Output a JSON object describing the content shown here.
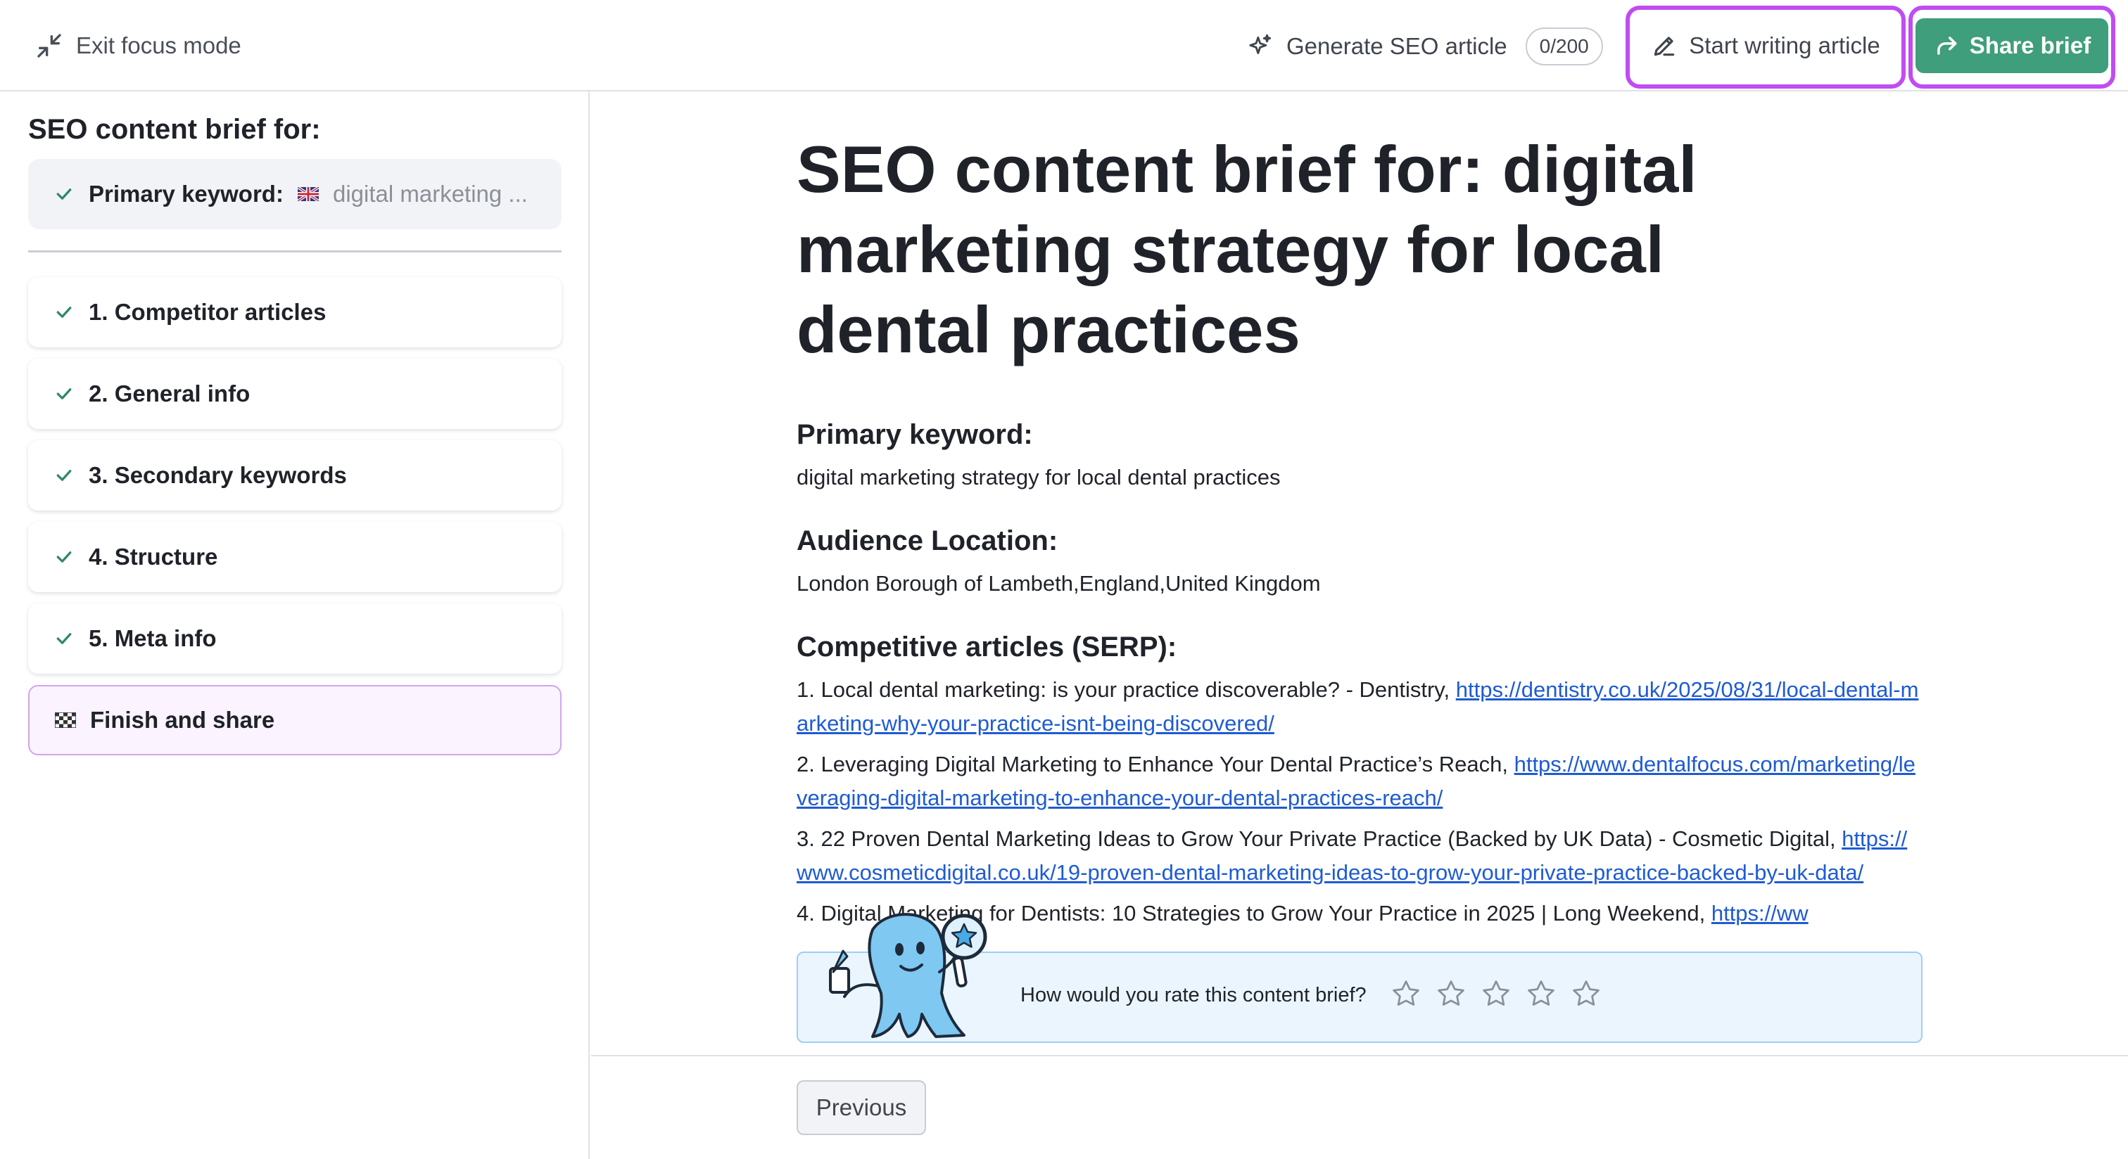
{
  "topbar": {
    "exit_focus_label": "Exit focus mode",
    "generate_label": "Generate SEO article",
    "generate_counter": "0/200",
    "start_writing_label": "Start writing article",
    "share_label": "Share brief"
  },
  "sidebar": {
    "title": "SEO content brief for:",
    "primary_keyword_label": "Primary keyword:",
    "primary_keyword_value": "digital marketing ...",
    "steps": [
      {
        "label": "1. Competitor articles"
      },
      {
        "label": "2. General info"
      },
      {
        "label": "3. Secondary keywords"
      },
      {
        "label": "4. Structure"
      },
      {
        "label": "5. Meta info"
      },
      {
        "label": "Finish and share"
      }
    ]
  },
  "main": {
    "title": "SEO content brief for: digital marketing strategy for local dental practices",
    "primary_keyword_heading": "Primary keyword:",
    "primary_keyword_text": "digital marketing strategy for local dental practices",
    "audience_heading": "Audience Location:",
    "audience_text": "London Borough of Lambeth,England,United Kingdom",
    "serp_heading": "Competitive articles (SERP):",
    "serp": [
      {
        "text": "1. Local dental marketing: is your practice discoverable? - Dentistry, ",
        "url": "https://dentistry.co.uk/2025/08/31/local-dental-marketing-why-your-practice-isnt-being-discovered/"
      },
      {
        "text": "2. Leveraging Digital Marketing to Enhance Your Dental Practice’s Reach, ",
        "url": "https://www.dentalfocus.com/marketing/leveraging-digital-marketing-to-enhance-your-dental-practices-reach/"
      },
      {
        "text": "3. 22 Proven Dental Marketing Ideas to Grow Your Private Practice (Backed by UK Data) - Cosmetic Digital, ",
        "url": "https://www.cosmeticdigital.co.uk/19-proven-dental-marketing-ideas-to-grow-your-private-practice-backed-by-uk-data/"
      },
      {
        "text": "4. Digital Marketing for Dentists: 10 Strategies to Grow Your Practice in 2025 | Long Weekend, ",
        "url": "https://ww"
      }
    ],
    "rating_prompt": "How would you rate this content brief?",
    "previous_label": "Previous"
  },
  "colors": {
    "accent_green": "#3f9e7c",
    "highlight_purple": "#c04cf2",
    "link_blue": "#1e5bd3",
    "check_green": "#2e8a64"
  }
}
